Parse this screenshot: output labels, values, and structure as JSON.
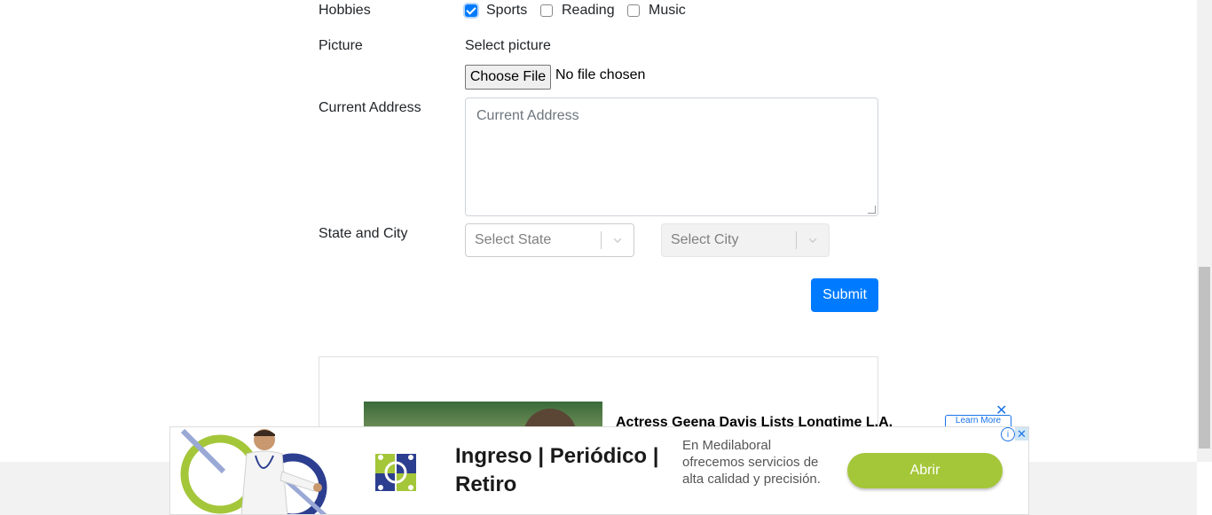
{
  "form": {
    "hobbies_label": "Hobbies",
    "hobbies": [
      {
        "label": "Sports",
        "checked": true
      },
      {
        "label": "Reading",
        "checked": false
      },
      {
        "label": "Music",
        "checked": false
      }
    ],
    "picture_label": "Picture",
    "picture_prompt": "Select picture",
    "file_button": "Choose File",
    "file_status": "No file chosen",
    "address_label": "Current Address",
    "address_placeholder": "Current Address",
    "state_city_label": "State and City",
    "state_placeholder": "Select State",
    "city_placeholder": "Select City",
    "submit_label": "Submit"
  },
  "ad_inline": {
    "headline": "Actress Geena Davis Lists Longtime L.A.",
    "learn_more": "Learn More",
    "close_icon": "close-icon"
  },
  "banner": {
    "headline": "Ingreso | Periódico | Retiro",
    "body": "En Medilaboral ofrecemos servicios de alta calidad y precisión.",
    "cta": "Abrir",
    "adchoices_icon": "info-icon",
    "close_icon": "close-icon"
  },
  "colors": {
    "primary": "#007bff",
    "cta_green": "#a4c639",
    "ad_blue": "#1a73e8"
  }
}
